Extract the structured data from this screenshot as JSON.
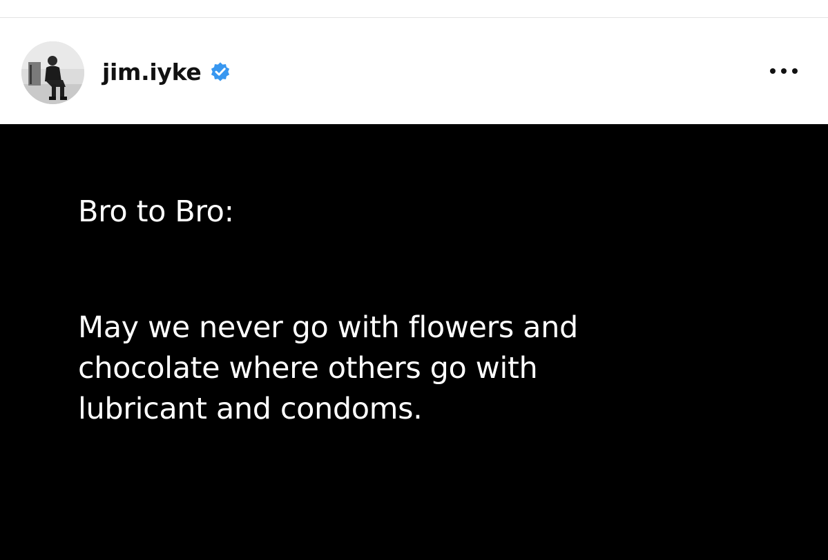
{
  "post": {
    "username": "jim.iyke",
    "verified_icon": "verified-badge-icon",
    "more_icon": "more-options-icon",
    "image_text": {
      "heading": "Bro to Bro:",
      "lines": [
        "May we never go with flowers and",
        "chocolate where others go with",
        "lubricant and condoms."
      ]
    }
  },
  "colors": {
    "verified_blue": "#3897f0",
    "image_background": "#000000",
    "image_text": "#ffffff"
  }
}
